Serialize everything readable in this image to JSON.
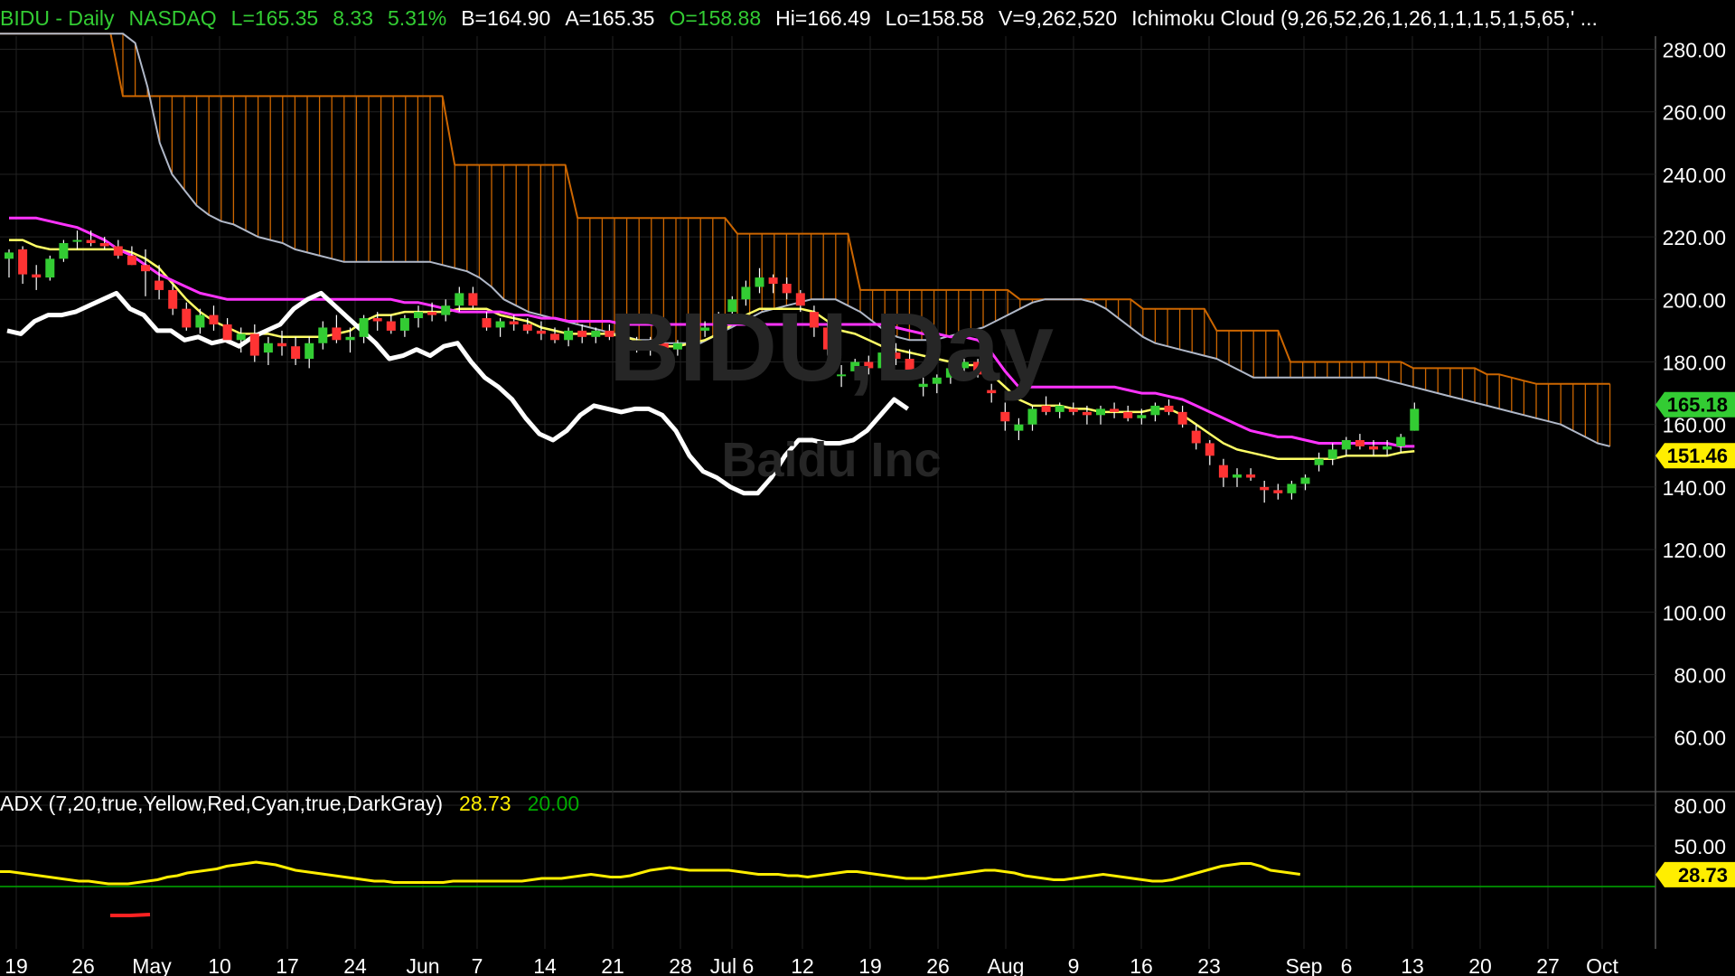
{
  "header": {
    "symbol_interval": "BIDU - Daily",
    "exchange": "NASDAQ",
    "last": "L=165.35",
    "change": "8.33",
    "change_pct": "5.31%",
    "bid": "B=164.90",
    "ask": "A=165.35",
    "open": "O=158.88",
    "high": "Hi=166.49",
    "low": "Lo=158.58",
    "volume": "V=9,262,520",
    "indicator": "Ichimoku Cloud (9,26,52,26,1,26,1,1,1,5,1,5,65,' ..."
  },
  "watermark": {
    "line1": "BIDU,Day",
    "line2": "Baidu Inc"
  },
  "price_labels": {
    "last": "165.18",
    "ma": "151.46"
  },
  "adx_header": {
    "label": "ADX (7,20,true,Yellow,Red,Cyan,true,DarkGray)",
    "value": "28.73",
    "threshold": "20.00"
  },
  "adx_label": "28.73",
  "colors": {
    "background": "#000000",
    "up": "#33cc33",
    "down": "#ff3333",
    "conversion": "#ffff66",
    "base": "#ff33ff",
    "lagging": "#ffffff",
    "cloud": "#cc6600",
    "span_b": "#b0b8c8",
    "adx": "#ffee00",
    "adx_low": "#ff2222",
    "threshold": "#00aa00",
    "grid": "#222222"
  },
  "chart_data": {
    "type": "candlestick",
    "y_axis": {
      "ticks": [
        "280.00",
        "260.00",
        "240.00",
        "220.00",
        "200.00",
        "180.00",
        "160.00",
        "140.00",
        "120.00",
        "100.00",
        "80.00",
        "60.00"
      ],
      "range": [
        40,
        292
      ]
    },
    "x_axis": {
      "ticks": [
        "19",
        "26",
        "May",
        "10",
        "17",
        "24",
        "Jun",
        "7",
        "14",
        "21",
        "28",
        "Jul 6",
        "12",
        "19",
        "26",
        "Aug",
        "9",
        "16",
        "23",
        "Sep",
        "6",
        "13",
        "20",
        "27",
        "Oct"
      ]
    },
    "candles": [
      [
        213,
        216,
        207,
        215
      ],
      [
        216,
        217,
        205,
        208
      ],
      [
        208,
        211,
        203,
        207
      ],
      [
        207,
        214,
        206,
        213
      ],
      [
        213,
        219,
        212,
        218
      ],
      [
        219,
        222,
        216,
        219
      ],
      [
        219,
        222,
        217,
        218
      ],
      [
        218,
        220,
        216,
        217
      ],
      [
        217,
        219,
        213,
        214
      ],
      [
        214,
        217,
        211,
        211
      ],
      [
        211,
        216,
        201,
        209
      ],
      [
        206,
        211,
        200,
        203
      ],
      [
        203,
        205,
        195,
        197
      ],
      [
        197,
        199,
        190,
        191
      ],
      [
        191,
        197,
        189,
        195
      ],
      [
        195,
        198,
        190,
        192
      ],
      [
        192,
        194,
        186,
        187
      ],
      [
        187,
        191,
        183,
        189
      ],
      [
        189,
        192,
        180,
        182
      ],
      [
        183,
        188,
        179,
        186
      ],
      [
        186,
        190,
        182,
        185
      ],
      [
        185,
        188,
        179,
        181
      ],
      [
        181,
        188,
        178,
        186
      ],
      [
        186,
        193,
        184,
        191
      ],
      [
        191,
        195,
        186,
        187
      ],
      [
        187,
        191,
        183,
        188
      ],
      [
        188,
        195,
        186,
        194
      ],
      [
        194,
        196,
        190,
        193
      ],
      [
        193,
        195,
        189,
        190
      ],
      [
        190,
        195,
        188,
        194
      ],
      [
        194,
        198,
        191,
        196
      ],
      [
        196,
        199,
        193,
        195
      ],
      [
        195,
        200,
        193,
        198
      ],
      [
        198,
        204,
        196,
        202
      ],
      [
        202,
        204,
        197,
        198
      ],
      [
        194,
        196,
        190,
        191
      ],
      [
        191,
        194,
        188,
        193
      ],
      [
        193,
        195,
        190,
        192
      ],
      [
        192,
        194,
        189,
        190
      ],
      [
        190,
        193,
        187,
        189
      ],
      [
        189,
        191,
        186,
        187
      ],
      [
        187,
        191,
        185,
        190
      ],
      [
        190,
        192,
        186,
        188
      ],
      [
        188,
        191,
        186,
        190
      ],
      [
        190,
        192,
        187,
        188
      ],
      [
        187,
        189,
        184,
        186
      ],
      [
        186,
        188,
        183,
        185
      ],
      [
        185,
        188,
        182,
        186
      ],
      [
        186,
        188,
        183,
        184
      ],
      [
        184,
        187,
        182,
        186
      ],
      [
        186,
        192,
        185,
        190
      ],
      [
        190,
        193,
        188,
        191
      ],
      [
        191,
        196,
        189,
        195
      ],
      [
        196,
        201,
        194,
        200
      ],
      [
        200,
        206,
        198,
        204
      ],
      [
        204,
        210,
        202,
        207
      ],
      [
        207,
        208,
        202,
        205
      ],
      [
        205,
        207,
        200,
        202
      ],
      [
        202,
        203,
        196,
        198
      ],
      [
        196,
        198,
        188,
        191
      ],
      [
        191,
        193,
        182,
        184
      ],
      [
        176,
        179,
        172,
        176
      ],
      [
        177,
        181,
        175,
        180
      ],
      [
        180,
        182,
        176,
        178
      ],
      [
        178,
        184,
        176,
        183
      ],
      [
        183,
        186,
        179,
        181
      ],
      [
        181,
        184,
        176,
        177
      ],
      [
        172,
        175,
        169,
        173
      ],
      [
        173,
        176,
        170,
        175
      ],
      [
        175,
        179,
        173,
        178
      ],
      [
        178,
        181,
        176,
        180
      ],
      [
        180,
        181,
        175,
        176
      ],
      [
        171,
        173,
        167,
        170
      ],
      [
        164,
        167,
        158,
        161
      ],
      [
        158,
        162,
        155,
        160
      ],
      [
        160,
        166,
        158,
        165
      ],
      [
        166,
        169,
        163,
        164
      ],
      [
        164,
        167,
        162,
        166
      ],
      [
        165,
        167,
        163,
        164
      ],
      [
        164,
        166,
        160,
        163
      ],
      [
        163,
        166,
        160,
        165
      ],
      [
        165,
        167,
        162,
        164
      ],
      [
        164,
        166,
        161,
        162
      ],
      [
        162,
        165,
        160,
        163
      ],
      [
        163,
        167,
        161,
        166
      ],
      [
        166,
        168,
        163,
        164
      ],
      [
        164,
        166,
        159,
        160
      ],
      [
        158,
        160,
        152,
        154
      ],
      [
        154,
        155,
        147,
        150
      ],
      [
        147,
        149,
        140,
        143
      ],
      [
        143,
        146,
        140,
        144
      ],
      [
        144,
        146,
        142,
        143
      ],
      [
        140,
        142,
        135,
        139
      ],
      [
        139,
        141,
        136,
        138
      ],
      [
        138,
        142,
        136,
        141
      ],
      [
        141,
        144,
        139,
        143
      ],
      [
        147,
        151,
        145,
        149
      ],
      [
        149,
        154,
        147,
        152
      ],
      [
        152,
        156,
        150,
        155
      ],
      [
        155,
        157,
        152,
        153
      ],
      [
        153,
        155,
        150,
        152
      ],
      [
        152,
        155,
        150,
        153
      ],
      [
        153,
        157,
        151,
        156
      ],
      [
        158,
        167,
        158,
        165
      ]
    ],
    "conversion_line": [
      219,
      219,
      217,
      216,
      216,
      216,
      216,
      216,
      216,
      215,
      213,
      210,
      205,
      200,
      196,
      193,
      191,
      189,
      189,
      189,
      188,
      188,
      188,
      188,
      189,
      190,
      193,
      195,
      195,
      196,
      196,
      196,
      196,
      197,
      197,
      197,
      195,
      194,
      193,
      191,
      190,
      189,
      189,
      189,
      189,
      188,
      187,
      186,
      185,
      185,
      186,
      187,
      189,
      192,
      195,
      197,
      197,
      197,
      197,
      196,
      193,
      190,
      189,
      187,
      185,
      184,
      183,
      182,
      181,
      180,
      179,
      179,
      176,
      172,
      168,
      166,
      166,
      166,
      165,
      165,
      164,
      164,
      164,
      164,
      165,
      165,
      163,
      160,
      157,
      154,
      152,
      151,
      150,
      149,
      149,
      149,
      149,
      149,
      150,
      150,
      150,
      150,
      151,
      151.46
    ],
    "base_line": [
      226,
      226,
      226,
      225,
      224,
      223,
      221,
      219,
      216,
      214,
      211,
      208,
      206,
      204,
      202,
      201,
      200,
      200,
      200,
      200,
      200,
      200,
      200,
      200,
      200,
      200,
      200,
      200,
      200,
      199,
      199,
      198,
      197,
      196,
      196,
      196,
      196,
      195,
      195,
      194,
      194,
      193,
      193,
      193,
      193,
      192,
      192,
      192,
      192,
      192,
      192,
      192,
      192,
      192,
      192,
      192,
      192,
      192,
      192,
      192,
      192,
      192,
      192,
      192,
      192,
      191,
      190,
      189,
      189,
      188,
      188,
      187,
      183,
      177,
      172,
      172,
      172,
      172,
      172,
      172,
      172,
      172,
      171,
      170,
      170,
      169,
      168,
      166,
      164,
      162,
      160,
      158,
      157,
      156,
      156,
      155,
      154,
      154,
      154,
      154,
      154,
      154,
      153,
      153
    ],
    "lagging_span": [
      190,
      189,
      193,
      195,
      195,
      196,
      198,
      200,
      202,
      197,
      195,
      190,
      190,
      187,
      188,
      186,
      187,
      185,
      188,
      190,
      192,
      197,
      200,
      202,
      198,
      194,
      190,
      186,
      181,
      182,
      184,
      182,
      185,
      186,
      180,
      175,
      172,
      168,
      162,
      157,
      155,
      158,
      163,
      166,
      165,
      164,
      165,
      165,
      163,
      158,
      150,
      145,
      143,
      140,
      138,
      138,
      143,
      150,
      155,
      155,
      154,
      154,
      155,
      158,
      163,
      168,
      165
    ],
    "span_a": [
      285,
      285,
      285,
      285,
      285,
      285,
      285,
      285,
      285,
      285,
      265,
      265,
      265,
      265,
      265,
      265,
      265,
      265,
      265,
      265,
      265,
      265,
      265,
      265,
      265,
      265,
      265,
      265,
      265,
      265,
      265,
      265,
      265,
      265,
      265,
      265,
      265,
      243,
      243,
      243,
      243,
      243,
      243,
      243,
      243,
      243,
      243,
      226,
      226,
      226,
      226,
      226,
      226,
      226,
      226,
      226,
      226,
      226,
      226,
      226,
      221,
      221,
      221,
      221,
      221,
      221,
      221,
      221,
      221,
      221,
      203,
      203,
      203,
      203,
      203,
      203,
      203,
      203,
      203,
      203,
      203,
      203,
      203,
      200,
      200,
      200,
      200,
      200,
      200,
      200,
      200,
      200,
      200,
      197,
      197,
      197,
      197,
      197,
      197,
      190,
      190,
      190,
      190,
      190,
      190,
      180,
      180,
      180,
      180,
      180,
      180,
      180,
      180,
      180,
      180,
      178,
      178,
      178,
      178,
      178,
      178,
      176,
      176,
      175,
      174,
      173,
      173,
      173,
      173,
      173,
      173,
      173,
      173,
      173,
      173
    ],
    "span_b": [
      285,
      285,
      285,
      285,
      285,
      285,
      285,
      285,
      285,
      285,
      285,
      282,
      268,
      250,
      240,
      235,
      230,
      227,
      225,
      224,
      222,
      220,
      219,
      218,
      216,
      215,
      214,
      213,
      212,
      212,
      212,
      212,
      212,
      212,
      212,
      212,
      211,
      210,
      209,
      207,
      204,
      200,
      198,
      196,
      195,
      194,
      193,
      192,
      191,
      190,
      189,
      188,
      187,
      187,
      186,
      186,
      186,
      186,
      188,
      190,
      192,
      194,
      196,
      197,
      198,
      199,
      200,
      200,
      200,
      198,
      196,
      193,
      190,
      188,
      187,
      187,
      187,
      188,
      189,
      190,
      191,
      193,
      195,
      197,
      199,
      200,
      200,
      200,
      200,
      199,
      197,
      194,
      191,
      188,
      186,
      185,
      184,
      183,
      182,
      181,
      179,
      177,
      175,
      175,
      175,
      175,
      175,
      175,
      175,
      175,
      175,
      175,
      175,
      174,
      173,
      172,
      171,
      170,
      169,
      168,
      167,
      166,
      165,
      164,
      163,
      162,
      161,
      160,
      158,
      156,
      154,
      153,
      152,
      151,
      151,
      151,
      151,
      151,
      152
    ],
    "adx": [
      31,
      31,
      30,
      29,
      28,
      27,
      26,
      25,
      24,
      24,
      23,
      22,
      22,
      22,
      23,
      24,
      25,
      27,
      28,
      30,
      31,
      32,
      33,
      35,
      36,
      37,
      38,
      37,
      36,
      34,
      32,
      31,
      30,
      29,
      28,
      27,
      26,
      25,
      24,
      24,
      23,
      23,
      23,
      23,
      23,
      23,
      24,
      24,
      24,
      24,
      24,
      24,
      24,
      24,
      25,
      26,
      26,
      26,
      27,
      28,
      29,
      28,
      27,
      27,
      28,
      30,
      32,
      33,
      34,
      33,
      32,
      32,
      32,
      32,
      32,
      31,
      30,
      29,
      29,
      29,
      28,
      28,
      27,
      28,
      29,
      30,
      31,
      31,
      30,
      29,
      28,
      27,
      26,
      26,
      26,
      27,
      28,
      29,
      30,
      31,
      32,
      32,
      31,
      30,
      28,
      27,
      26,
      25,
      25,
      26,
      27,
      28,
      29,
      28,
      27,
      26,
      25,
      24,
      24,
      25,
      27,
      29,
      31,
      33,
      35,
      36,
      37,
      37,
      35,
      32,
      31,
      30,
      29,
      28,
      27,
      27,
      28.73
    ],
    "adx_axis": {
      "ticks": [
        "80.00",
        "50.00",
        "28.73"
      ],
      "range": [
        0,
        100
      ]
    }
  }
}
